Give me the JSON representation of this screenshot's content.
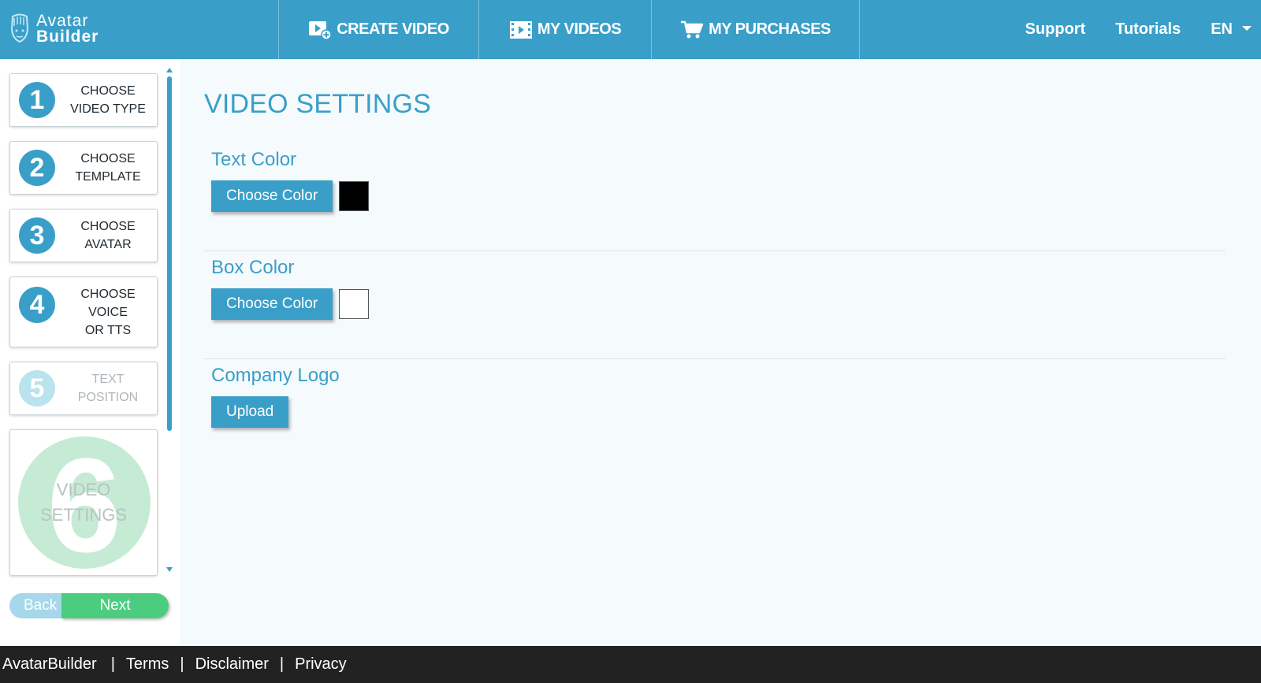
{
  "app": {
    "logo_line1": "Avatar",
    "logo_line2": "Builder",
    "brand_color": "#3a9fc8"
  },
  "nav": {
    "create_video": "CREATE VIDEO",
    "my_videos": "MY VIDEOS",
    "my_purchases": "MY PURCHASES",
    "support": "Support",
    "tutorials": "Tutorials",
    "language": "EN"
  },
  "steps": [
    {
      "number": "1",
      "label_lines": [
        "CHOOSE",
        "VIDEO TYPE"
      ],
      "enabled": true
    },
    {
      "number": "2",
      "label_lines": [
        "CHOOSE",
        "TEMPLATE"
      ],
      "enabled": true
    },
    {
      "number": "3",
      "label_lines": [
        "CHOOSE",
        "AVATAR"
      ],
      "enabled": true
    },
    {
      "number": "4",
      "label_lines": [
        "CHOOSE",
        "VOICE",
        "OR TTS"
      ],
      "enabled": true
    },
    {
      "number": "5",
      "label_lines": [
        "TEXT",
        "POSITION"
      ],
      "enabled": false
    },
    {
      "number": "6",
      "label_lines": [
        "VIDEO",
        "SETTINGS"
      ],
      "enabled": false
    }
  ],
  "wizard": {
    "back_label": "Back",
    "next_label": "Next"
  },
  "main": {
    "title": "VIDEO SETTINGS",
    "text_color": {
      "heading": "Text Color",
      "button": "Choose Color",
      "swatch": "#000000"
    },
    "box_color": {
      "heading": "Box Color",
      "button": "Choose Color",
      "swatch": "#ffffff"
    },
    "company_logo": {
      "heading": "Company Logo",
      "button": "Upload"
    }
  },
  "footer": {
    "brand": "AvatarBuilder",
    "terms": "Terms",
    "disclaimer": "Disclaimer",
    "privacy": "Privacy",
    "separator": "|"
  }
}
